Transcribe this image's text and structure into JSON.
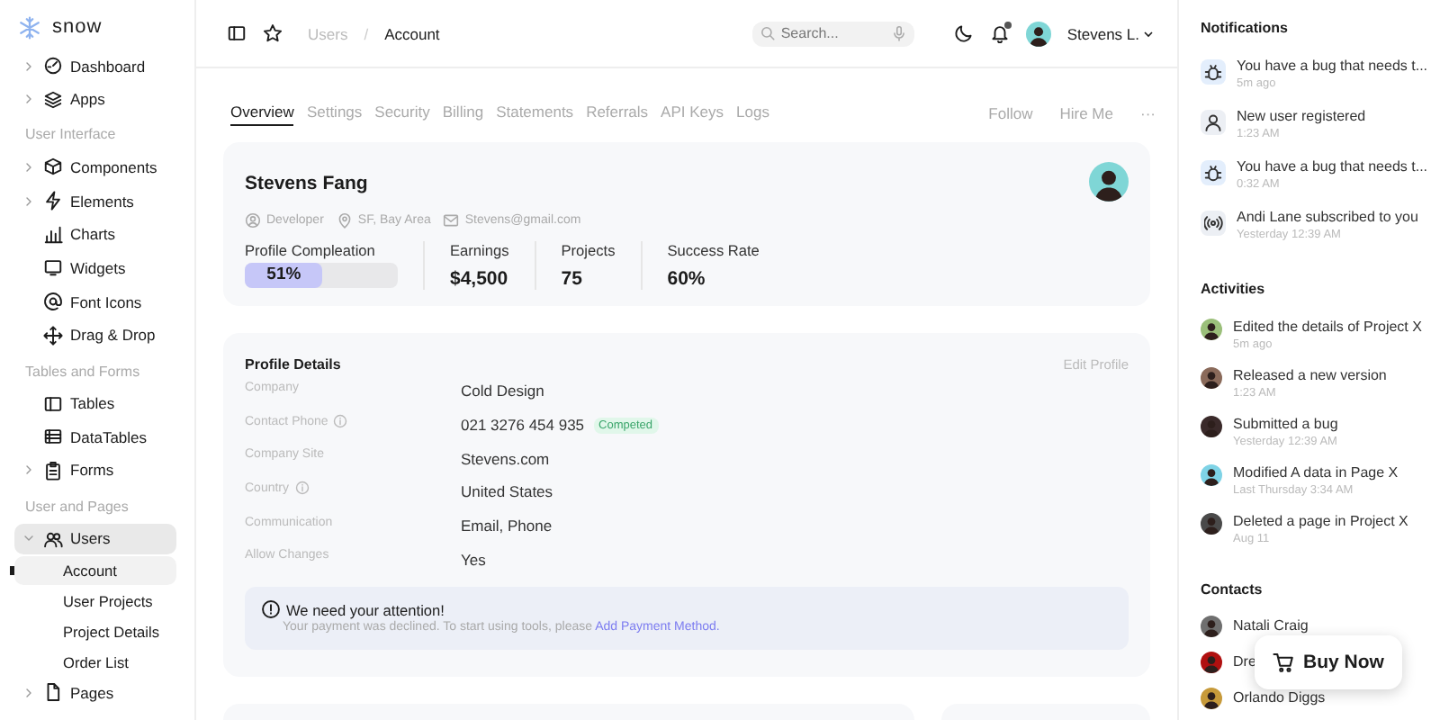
{
  "brand": {
    "name": "snow"
  },
  "sidebar": {
    "sections": [
      {
        "items": [
          {
            "label": "Dashboard",
            "expandable": true,
            "expanded": false,
            "selected": false
          },
          {
            "label": "Apps",
            "expandable": true,
            "expanded": false,
            "selected": false
          }
        ]
      },
      {
        "title": "User Interface",
        "items": [
          {
            "label": "Components",
            "expandable": true,
            "expanded": false,
            "selected": false
          },
          {
            "label": "Elements",
            "expandable": true,
            "expanded": false,
            "selected": false
          },
          {
            "label": "Charts",
            "expandable": false,
            "selected": false
          },
          {
            "label": "Widgets",
            "expandable": false,
            "selected": false
          },
          {
            "label": "Font Icons",
            "expandable": false,
            "selected": false
          },
          {
            "label": "Drag & Drop",
            "expandable": false,
            "selected": false
          }
        ]
      },
      {
        "title": "Tables and Forms",
        "items": [
          {
            "label": "Tables",
            "expandable": false,
            "selected": false
          },
          {
            "label": "DataTables",
            "expandable": false,
            "selected": false
          },
          {
            "label": "Forms",
            "expandable": true,
            "expanded": false,
            "selected": false
          }
        ]
      },
      {
        "title": "User and Pages",
        "items": [
          {
            "label": "Users",
            "expandable": true,
            "expanded": true,
            "selected": true,
            "children": [
              {
                "label": "Account",
                "selected": true
              },
              {
                "label": "User Projects",
                "selected": false
              },
              {
                "label": "Project Details",
                "selected": false
              },
              {
                "label": "Order List",
                "selected": false
              }
            ]
          },
          {
            "label": "Pages",
            "expandable": true,
            "expanded": false,
            "selected": false
          }
        ]
      }
    ]
  },
  "topbar": {
    "breadcrumb": [
      "Users",
      "Account"
    ],
    "breadcrumb_separator": "/",
    "search": {
      "placeholder": "Search..."
    },
    "user": {
      "name": "Stevens L."
    },
    "notification_dot": true
  },
  "tabs": [
    {
      "label": "Overview",
      "selected": true
    },
    {
      "label": "Settings",
      "selected": false
    },
    {
      "label": "Security",
      "selected": false
    },
    {
      "label": "Billing",
      "selected": false
    },
    {
      "label": "Statements",
      "selected": false
    },
    {
      "label": "Referrals",
      "selected": false
    },
    {
      "label": "API Keys",
      "selected": false
    },
    {
      "label": "Logs",
      "selected": false
    }
  ],
  "actions": [
    "Follow",
    "Hire Me",
    "···"
  ],
  "profile": {
    "name": "Stevens Fang",
    "meta": [
      "Developer",
      "SF, Bay Area",
      "Stevens@gmail.com"
    ],
    "stats": [
      {
        "kind": "progress",
        "label": "Profile Compleation",
        "level": 0.51,
        "reading": "51%"
      },
      {
        "kind": "value",
        "label": "Earnings",
        "value": "$4,500"
      },
      {
        "kind": "value",
        "label": "Projects",
        "value": "75"
      },
      {
        "kind": "value",
        "label": "Success Rate",
        "value": "60%"
      }
    ]
  },
  "details": {
    "title": "Profile Details",
    "action": "Edit Profile",
    "rows": [
      {
        "label": "Company",
        "value": "Cold Design",
        "info": false
      },
      {
        "label": "Contact Phone",
        "value": "021 3276 454 935",
        "info": true,
        "badge": "Competed"
      },
      {
        "label": "Company Site",
        "value": "Stevens.com",
        "info": false
      },
      {
        "label": "Country",
        "value": "United States",
        "info": true
      },
      {
        "label": "Communication",
        "value": "Email, Phone",
        "info": false
      },
      {
        "label": "Allow Changes",
        "value": "Yes",
        "info": false
      }
    ],
    "alert": {
      "title": "We need your attention!",
      "text": "Your payment was declined. To start using tools, please ",
      "link": "Add Payment Method."
    }
  },
  "notifications": {
    "title": "Notifications",
    "items": [
      {
        "text": "You have a bug that needs t...",
        "time": "5m ago"
      },
      {
        "text": "New user registered",
        "time": "1:23 AM"
      },
      {
        "text": "You have a bug that needs t...",
        "time": "0:32 AM"
      },
      {
        "text": "Andi Lane subscribed to you",
        "time": "Yesterday 12:39 AM"
      }
    ]
  },
  "activities": {
    "title": "Activities",
    "items": [
      {
        "text": "Edited the details of Project X",
        "time": "5m ago"
      },
      {
        "text": "Released a new version",
        "time": "1:23 AM"
      },
      {
        "text": "Submitted a bug",
        "time": "Yesterday 12:39 AM"
      },
      {
        "text": "Modified A data in Page X",
        "time": "Last Thursday 3:34 AM"
      },
      {
        "text": "Deleted a page in Project X",
        "time": "Aug 11"
      }
    ]
  },
  "contacts": {
    "title": "Contacts",
    "items": [
      {
        "name": "Natali Craig"
      },
      {
        "name": "Dre"
      },
      {
        "name": "Orlando Diggs"
      }
    ]
  },
  "buy_button": {
    "label": "Buy Now"
  }
}
